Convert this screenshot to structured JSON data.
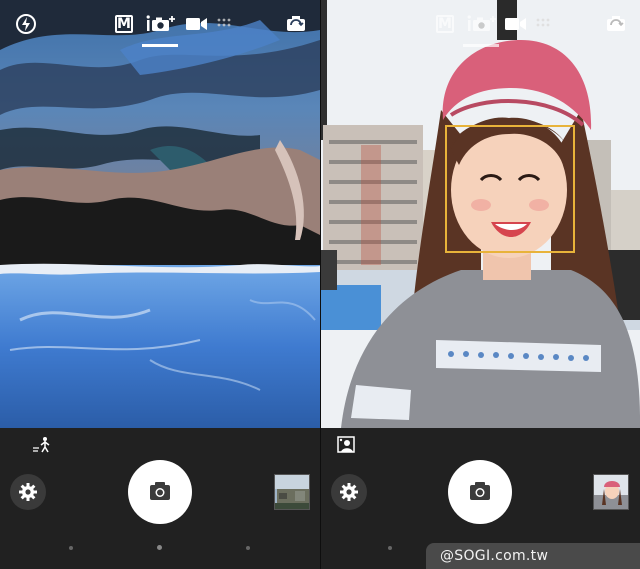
{
  "left_screen": {
    "top_icons": [
      "flash-off-icon",
      "manual-mode-icon",
      "superior-auto-icon",
      "video-icon",
      "apps-grid-icon",
      "switch-camera-icon"
    ],
    "manual_mode_label": "M",
    "scene_indicator_icon": "scene-landscape-icon",
    "page_dots": 3,
    "active_page": 2
  },
  "right_screen": {
    "top_icons": [
      "manual-mode-icon",
      "superior-auto-icon",
      "video-icon",
      "apps-grid-icon",
      "switch-camera-icon"
    ],
    "manual_mode_label": "M",
    "scene_indicator_icon": "scene-portrait-icon",
    "face_detection": true,
    "page_dots": 3,
    "active_page": 2
  },
  "watermark": "@SOGI.com.tw",
  "colors": {
    "bottom_bar": "#212121",
    "face_frame": "#e8b33a",
    "watermark_bg": "#4a4a4a"
  }
}
